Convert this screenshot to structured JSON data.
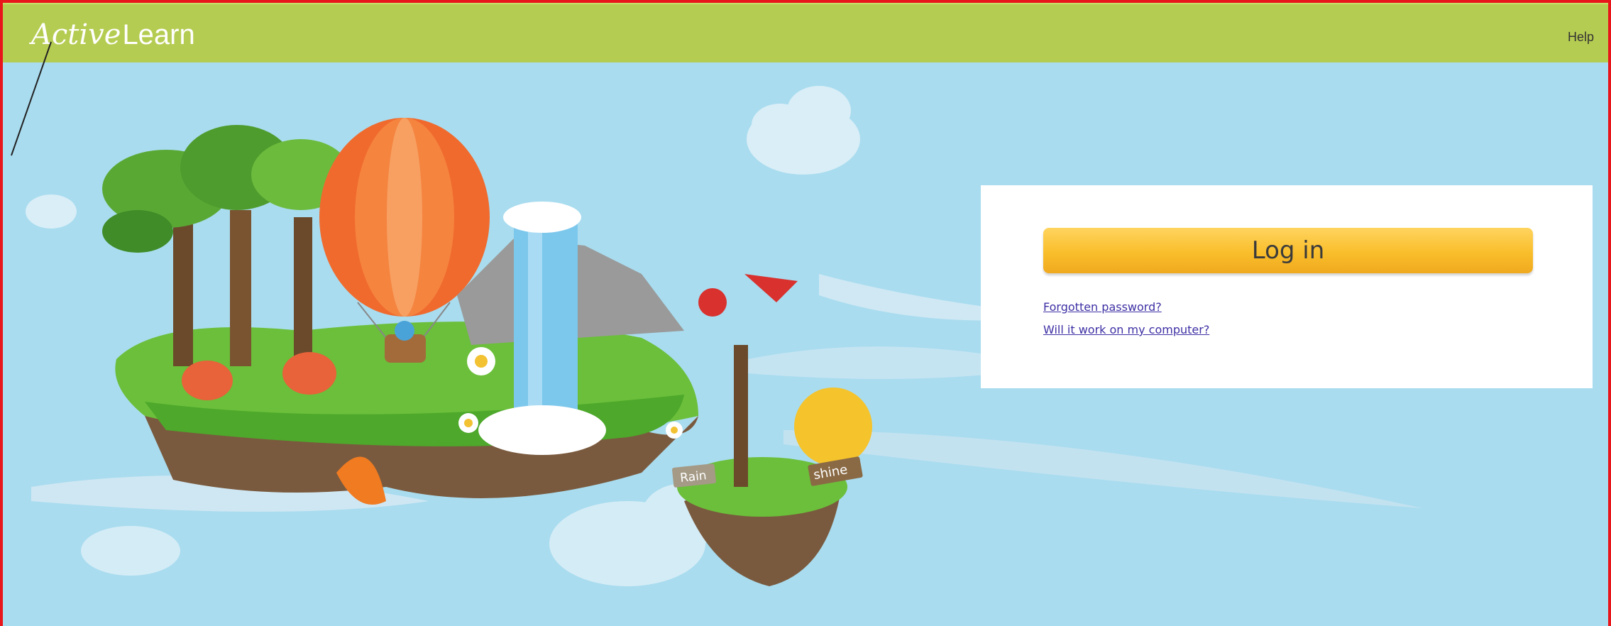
{
  "header": {
    "logo_part1": "Active",
    "logo_part2": "Learn",
    "help_label": "Help"
  },
  "login_panel": {
    "login_button_label": "Log in",
    "forgot_password_link": "Forgotten password?",
    "compatibility_link": "Will it work on my computer?"
  },
  "scene_labels": {
    "rain_sign": "Rain",
    "shine_sign": "shine"
  },
  "colors": {
    "header_bg": "#b5cc52",
    "sky": "#a9dcef",
    "button": "#f9be2b",
    "frame_border": "#e8161b",
    "link": "#3d30a4"
  }
}
